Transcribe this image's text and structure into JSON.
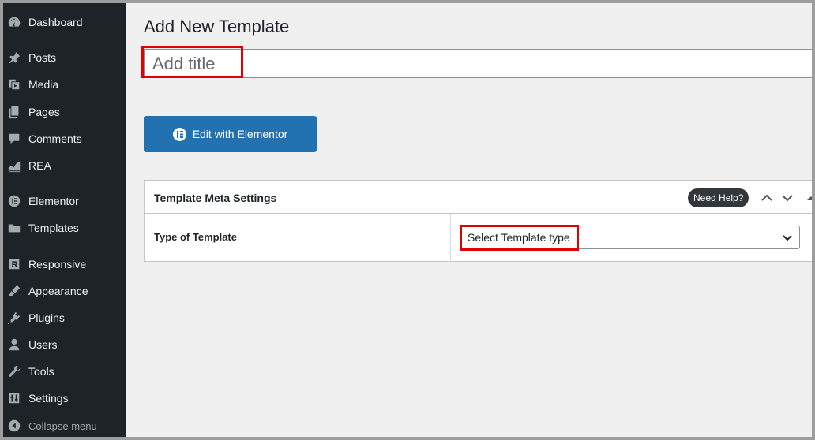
{
  "sidebar": {
    "items": [
      {
        "label": "Dashboard",
        "icon": "dashboard-icon"
      },
      {
        "label": "Posts",
        "icon": "pin-icon"
      },
      {
        "label": "Media",
        "icon": "media-icon"
      },
      {
        "label": "Pages",
        "icon": "pages-icon"
      },
      {
        "label": "Comments",
        "icon": "comment-icon"
      },
      {
        "label": "REA",
        "icon": "chart-icon"
      },
      {
        "label": "Elementor",
        "icon": "elementor-icon"
      },
      {
        "label": "Templates",
        "icon": "folder-icon"
      },
      {
        "label": "Responsive",
        "icon": "responsive-icon"
      },
      {
        "label": "Appearance",
        "icon": "brush-icon"
      },
      {
        "label": "Plugins",
        "icon": "plugin-icon"
      },
      {
        "label": "Users",
        "icon": "user-icon"
      },
      {
        "label": "Tools",
        "icon": "wrench-icon"
      },
      {
        "label": "Settings",
        "icon": "settings-icon"
      }
    ],
    "collapse_label": "Collapse menu"
  },
  "main": {
    "page_title": "Add New Template",
    "title_placeholder": "Add title",
    "elementor_button_label": "Edit with Elementor"
  },
  "metabox": {
    "title": "Template Meta Settings",
    "help_label": "Need Help?",
    "row_label": "Type of Template",
    "select_value": "Select Template type"
  },
  "colors": {
    "sidebar_bg": "#1d2327",
    "accent": "#2271b1",
    "highlight": "#e00000"
  }
}
